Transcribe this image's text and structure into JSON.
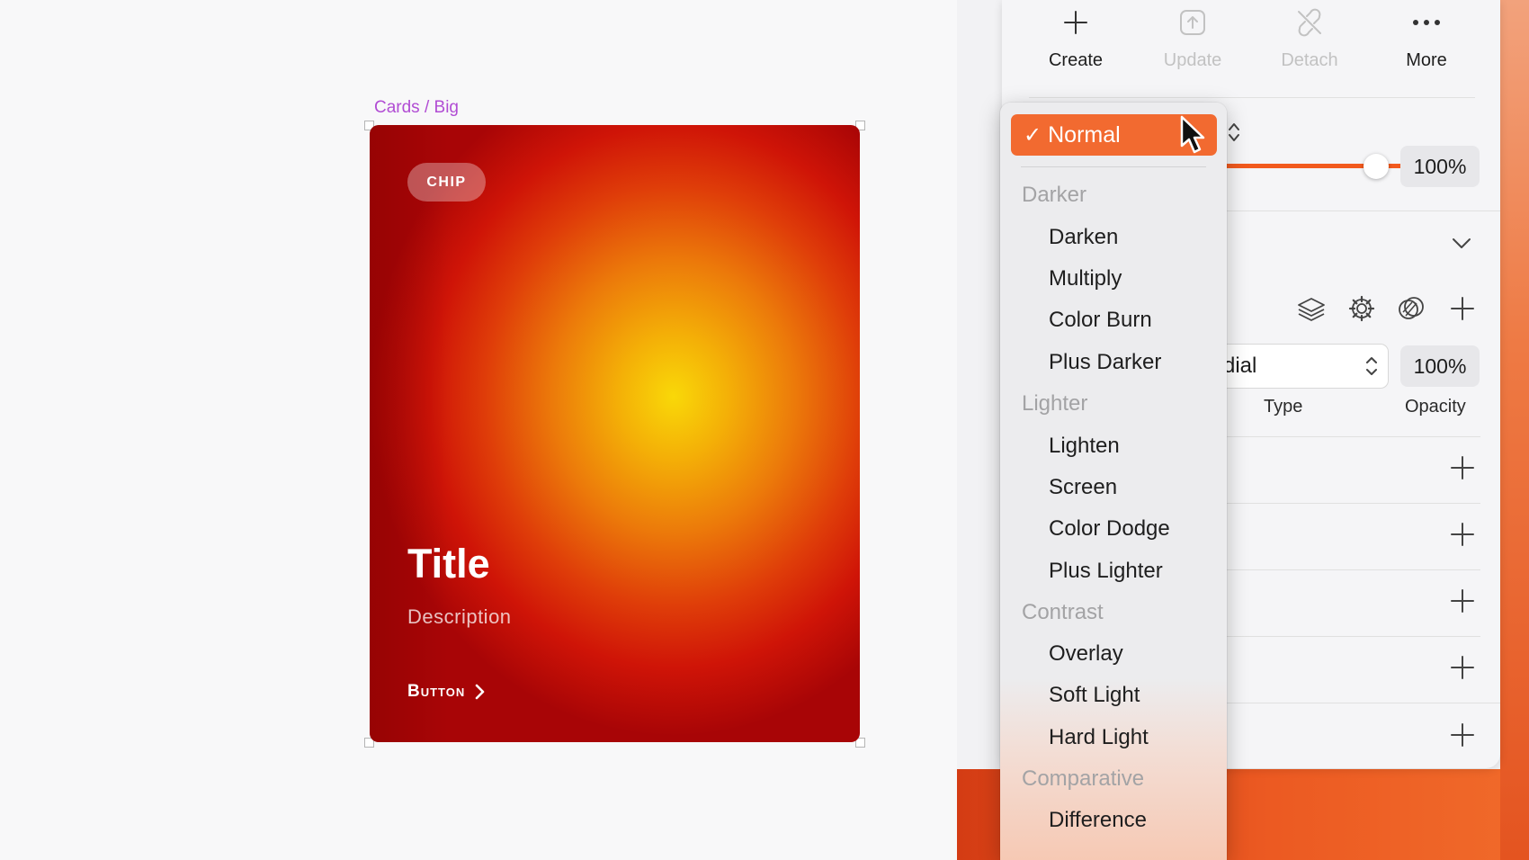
{
  "canvas": {
    "frame_label": "Cards / Big",
    "card": {
      "chip": "CHIP",
      "title": "Title",
      "description": "Description",
      "button_label": "Button"
    }
  },
  "toolbar": {
    "create": "Create",
    "update": "Update",
    "detach": "Detach",
    "more": "More"
  },
  "inspector": {
    "layer_opacity": "100%",
    "fill_type_value": "dial",
    "fill_opacity": "100%",
    "type_label": "Type",
    "opacity_label": "Opacity"
  },
  "blend_menu": {
    "selected": "Normal",
    "check": "✓",
    "groups": [
      {
        "header": "Darker",
        "items": [
          "Darken",
          "Multiply",
          "Color Burn",
          "Plus Darker"
        ]
      },
      {
        "header": "Lighter",
        "items": [
          "Lighten",
          "Screen",
          "Color Dodge",
          "Plus Lighter"
        ]
      },
      {
        "header": "Contrast",
        "items": [
          "Overlay",
          "Soft Light",
          "Hard Light"
        ]
      },
      {
        "header": "Comparative",
        "items": [
          "Difference"
        ]
      }
    ]
  },
  "colors": {
    "accent": "#f26a30",
    "frame_label": "#b14dd4",
    "slider": "#f25a1e"
  }
}
